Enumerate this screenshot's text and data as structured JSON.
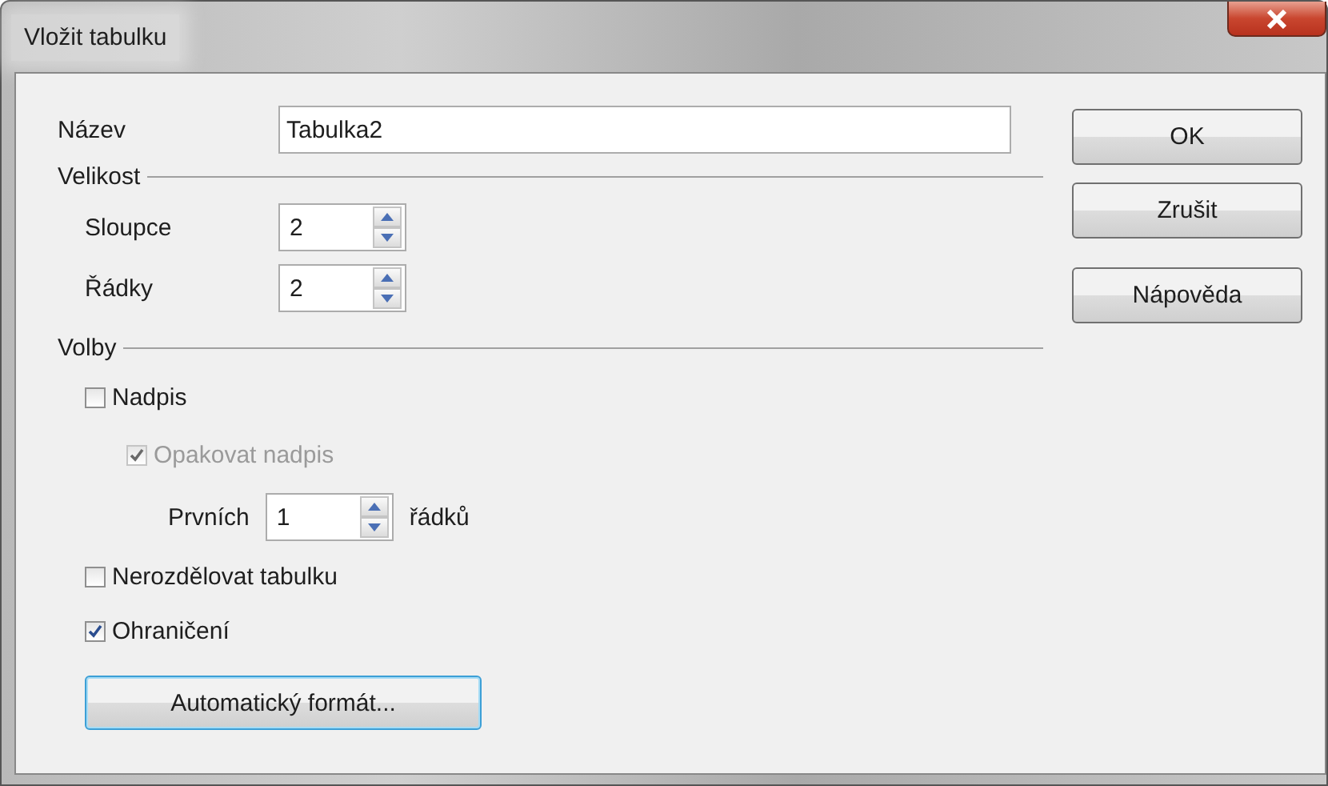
{
  "window": {
    "title": "Vložit tabulku"
  },
  "name_field": {
    "label": "Název",
    "value": "Tabulka2"
  },
  "size": {
    "title": "Velikost",
    "fields": [
      {
        "label": "Sloupce",
        "value": "2"
      },
      {
        "label": "Řádky",
        "value": "2"
      }
    ]
  },
  "options": {
    "title": "Volby",
    "items": [
      {
        "kind": "checkbox",
        "label": "Nadpis",
        "checked": false,
        "disabled": false,
        "children": [
          {
            "kind": "checkbox",
            "label": "Opakovat nadpis",
            "checked": true,
            "disabled": true,
            "children": [
              {
                "kind": "spin",
                "label": "Prvních",
                "value": "1",
                "suffix": "řádků"
              }
            ]
          }
        ]
      },
      {
        "kind": "checkbox",
        "label": "Nerozdělovat tabulku",
        "checked": false,
        "disabled": false
      },
      {
        "kind": "checkbox",
        "label": "Ohraničení",
        "checked": true,
        "disabled": false
      }
    ],
    "button": {
      "label": "Automatický formát...",
      "focused": true
    }
  },
  "buttons": [
    "OK",
    "Zrušit",
    "Nápověda"
  ]
}
